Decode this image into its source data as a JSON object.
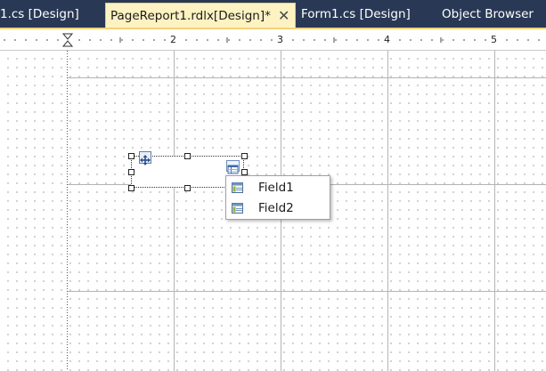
{
  "tabs": [
    {
      "label": "1.cs [Design]",
      "active": false
    },
    {
      "label": "PageReport1.rdlx[Design]*",
      "active": true
    },
    {
      "label": "Form1.cs [Design]",
      "active": false
    },
    {
      "label": "Object Browser",
      "active": false
    }
  ],
  "tab_close_glyph": "✕",
  "ruler": {
    "numbers": [
      "2",
      "3",
      "4",
      "5"
    ]
  },
  "field_list": {
    "items": [
      "Field1",
      "Field2"
    ]
  },
  "colors": {
    "tab_bar": "#293955",
    "active_tab": "#fdf2c2",
    "accent": "#f3d27a"
  }
}
